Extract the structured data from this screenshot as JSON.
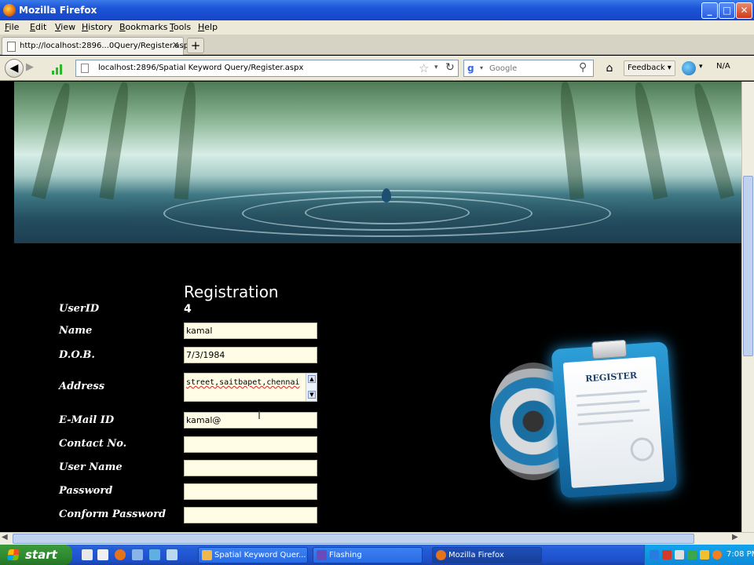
{
  "window": {
    "title": "Mozilla Firefox",
    "controls": {
      "minimize": "_",
      "maximize": "□",
      "close": "✕"
    }
  },
  "menu": [
    "File",
    "Edit",
    "View",
    "History",
    "Bookmarks",
    "Tools",
    "Help"
  ],
  "tab": {
    "label": "http://localhost:2896...0Query/Register.aspx",
    "close": "✕",
    "new_tab": "+"
  },
  "nav": {
    "url": "localhost:2896/Spatial Keyword Query/Register.aspx",
    "search_placeholder": "Google",
    "search_engine": "g",
    "feedback_label": "Feedback ▾",
    "na_label": "N/A"
  },
  "form": {
    "title": "Registration",
    "labels": {
      "userid": "UserID",
      "name": "Name",
      "dob": "D.O.B.",
      "address": "Address",
      "email": "E-Mail ID",
      "contact": "Contact No.",
      "username": "User Name",
      "password": "Password",
      "confirm": "Conform Password"
    },
    "userid_value": "4",
    "name_value": "kamal",
    "dob_value": "7/3/1984",
    "address_value": "street,saitbapet,chennai",
    "email_value": "kamal@",
    "contact_value": "",
    "username_value": "",
    "password_value": "",
    "confirm_value": ""
  },
  "art": {
    "label": "REGISTER"
  },
  "taskbar": {
    "start_label": "start",
    "tasks": [
      "Spatial Keyword Quer...",
      "Flashing",
      "Mozilla Firefox"
    ],
    "clock": "7:08 PM"
  },
  "colors": {
    "titlebar": "#1c55d8",
    "input_bg": "#fffde6",
    "taskbar": "#245dd9",
    "start_green": "#2f8a2f"
  }
}
